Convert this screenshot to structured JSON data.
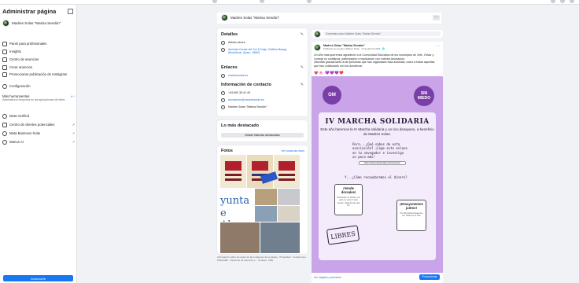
{
  "sidebar": {
    "title": "Administrar página",
    "page_name": "Madres Solas \"Marisa Sendón\"",
    "items": [
      {
        "label": "Panel para profesionales"
      },
      {
        "label": "Insights"
      },
      {
        "label": "Centro de anuncios"
      },
      {
        "label": "Crear anuncios"
      },
      {
        "label": "Promocionar publicación de Instagram"
      },
      {
        "label": "Configuración"
      }
    ],
    "tools": {
      "label": "Más herramientas",
      "badge": "4 ^",
      "subtitle": "Administra tu empresa en las aplicaciones de Meta."
    },
    "tool_items": [
      {
        "label": "Meta Verified",
        "arrow": ""
      },
      {
        "label": "Centro de clientes potenciales",
        "arrow": "↗"
      },
      {
        "label": "Meta Business Suite",
        "arrow": "↗"
      },
      {
        "label": "Manus AI",
        "arrow": "↗"
      }
    ],
    "cta": "Anunciarte"
  },
  "header": {
    "page_name": "Madres Solas \"Marisa Sendón\"",
    "more": "···"
  },
  "details": {
    "title": "Detalles",
    "hours": "Abierto ahora",
    "address": "Avenida Conde del Sol 13 bajo, Edificio Basaq, Almuñécar, Spain, 18690",
    "links_title": "Enlaces",
    "link": "madressolas.es",
    "contact_title": "Información de contacto",
    "phone": "+34 600 35 41 49",
    "email": "asociacion@madressolas.es",
    "messenger": "Madres Solas \"Marisa Sendón\""
  },
  "featured": {
    "title": "Lo más destacado",
    "button": "Añadir historias destacadas"
  },
  "photos": {
    "title": "Fotos",
    "see_all": "Ver todas las fotos",
    "poster_title": "III MARCHA",
    "poster_sub": "SOLIDARIA",
    "text_top": "yunta",
    "text_bottom": "e Almu"
  },
  "footer_note": "Información sobre los datos de las imágenes de la página · Privacidad · Condiciones · Publicidad · Opciones de anuncios ▷ · Cookies · Más",
  "composer": {
    "placeholder": "Comentas como Madres Solas \"Marisa Sendón\""
  },
  "post": {
    "author": "Madres Solas \"Marisa Sendón\"",
    "meta": "Publicado por Ayuda a Madres Solas · 10 de abril de 2025 · 🌐",
    "text": "Un año más queremos agradecer a la Comunidad Educativa de los municipios de Jete, Otívar y Lentegí su confianza, participación e implicación con nuestra Asociación.",
    "text2": "¡Muchas gracias tanto a las personas que han organizado esta actividad, como a todas aquellas que han colaborado con los donativos!",
    "emojis": "💗🌸 💜💜💜❤️",
    "flyer_title": "IV MARCHA SOLIDARIA",
    "flyer_sub": "Este año haremos la IV Marcha solidaria y un rico desayuno, a beneficio de Madres Solas.",
    "flyer_q1": "Pero...¿Qué sabes de esta asociación? ¡Coge este enlace en tu navegador e investiga un poco más!",
    "flyer_url": "https://www.madressolas.es/conocenos/",
    "flyer_q2": "Y...¿Cómo recaudaremos el dinero?",
    "box1_title": "¡Vende dorsales!",
    "box1_text": "Vendiendo un dorsal, uno para ti y otros 2 para vender. Cada dorsal vale 2 €.",
    "box2_title": "¡Desayunemos juntos!",
    "box2_text": "Por 2€ podrás desayunar con tostás en el cole.",
    "libres": "LIBRES",
    "sin_miedo": "SIN MIEDO",
    "om": "OM",
    "footer_link": "Ver insights y anuncios",
    "promote": "Promocionar"
  }
}
